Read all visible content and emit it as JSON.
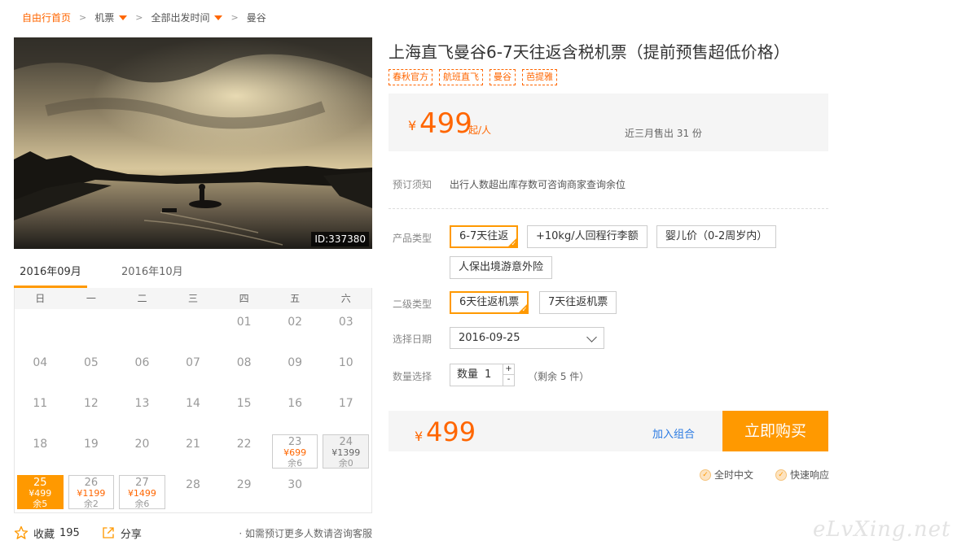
{
  "breadcrumb": {
    "home": "自由行首页",
    "sep": ">",
    "items": [
      "机票",
      "全部出发时间",
      "曼谷"
    ]
  },
  "photo": {
    "id_label": "ID:337380"
  },
  "calendar": {
    "months": [
      "2016年09月",
      "2016年10月"
    ],
    "weekdays": [
      "日",
      "一",
      "二",
      "三",
      "四",
      "五",
      "六"
    ],
    "days": {
      "d01": "01",
      "d02": "02",
      "d03": "03",
      "d04": "04",
      "d05": "05",
      "d06": "06",
      "d07": "07",
      "d08": "08",
      "d09": "09",
      "d10": "10",
      "d11": "11",
      "d12": "12",
      "d13": "13",
      "d14": "14",
      "d15": "15",
      "d16": "16",
      "d17": "17",
      "d18": "18",
      "d19": "19",
      "d20": "20",
      "d21": "21",
      "d22": "22",
      "d28": "28",
      "d29": "29",
      "d30": "30"
    },
    "priced": {
      "d23": {
        "day": "23",
        "price": "¥699",
        "remain": "余6"
      },
      "d24": {
        "day": "24",
        "price": "¥1399",
        "remain": "余0"
      },
      "d25": {
        "day": "25",
        "price": "¥499",
        "remain": "余5"
      },
      "d26": {
        "day": "26",
        "price": "¥1199",
        "remain": "余2"
      },
      "d27": {
        "day": "27",
        "price": "¥1499",
        "remain": "余6"
      }
    }
  },
  "footer": {
    "favorite_label": "收藏",
    "favorite_count": "195",
    "share_label": "分享",
    "note": "· 如需预订更多人数请咨询客服"
  },
  "product": {
    "title": "上海直飞曼谷6-7天往返含税机票（提前预售超低价格）",
    "tags": [
      "春秋官方",
      "航班直飞",
      "曼谷",
      "芭提雅"
    ],
    "price_currency": "¥",
    "price": "499",
    "price_unit": "起/人",
    "sold": "近三月售出 31 份"
  },
  "booking": {
    "notice_label": "预订须知",
    "notice_text": "出行人数超出库存数可咨询商家查询余位",
    "type_label": "产品类型",
    "type_options": [
      "6-7天往返",
      "+10kg/人回程行李额",
      "婴儿价（0-2周岁内）",
      "人保出境游意外险"
    ],
    "subtype_label": "二级类型",
    "subtype_options": [
      "6天往返机票",
      "7天往返机票"
    ],
    "date_label": "选择日期",
    "date_value": "2016-09-25",
    "qty_label": "数量选择",
    "qty_prefix": "数量",
    "qty_value": "1",
    "qty_plus": "+",
    "qty_minus": "-",
    "qty_remain": "（剩余 5 件）"
  },
  "buy": {
    "currency": "¥",
    "total": "499",
    "combo_label": "加入组合",
    "buy_label": "立即购买"
  },
  "services": [
    "全时中文",
    "快速响应"
  ],
  "watermark": "eLvXing.net",
  "colors": {
    "accent": "#ff9900",
    "price": "#ff6600",
    "link": "#2a7ae2"
  }
}
